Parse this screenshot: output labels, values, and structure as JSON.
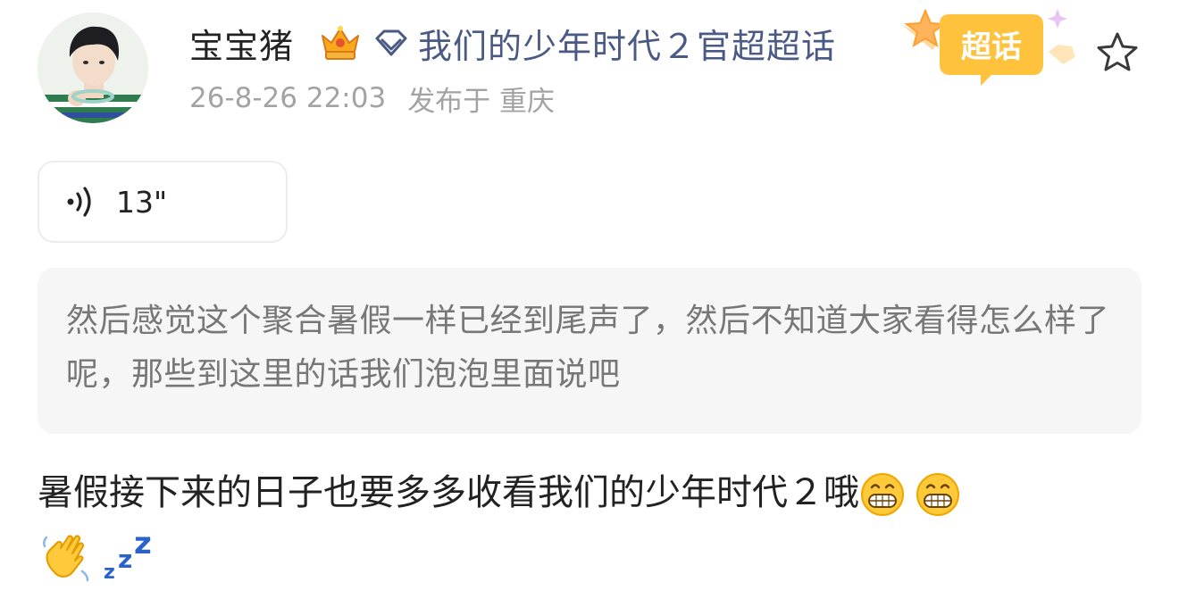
{
  "post": {
    "author": "宝宝猪",
    "topic": "我们的少年时代２官超超话",
    "super_topic_badge": "超话",
    "date": "26-8-26 22:03",
    "location": "发布于 重庆",
    "voice_duration": "13\"",
    "quote_text": "然后感觉这个聚合暑假一样已经到尾声了，然后不知道大家看得怎么样了呢，那些到这里的话我们泡泡里面说吧",
    "body_text": "暑假接下来的日子也要多多收看我们的少年时代２哦"
  },
  "icons": {
    "avatar": "avatar-photo",
    "crown": "crown-badge-icon",
    "topic": "diamond-icon",
    "super_topic": "super-topic-badge-icon",
    "favorite": "star-outline-icon",
    "voice": "voice-wave-icon",
    "emojis": [
      "grin-emoji",
      "grin-emoji",
      "waving-hand-emoji",
      "zzz-emoji"
    ]
  },
  "colors": {
    "topic_link": "#4a5a84",
    "meta_text": "#a3a3a3",
    "quote_background": "#f6f6f6",
    "badge_orange": "#f6a623"
  }
}
